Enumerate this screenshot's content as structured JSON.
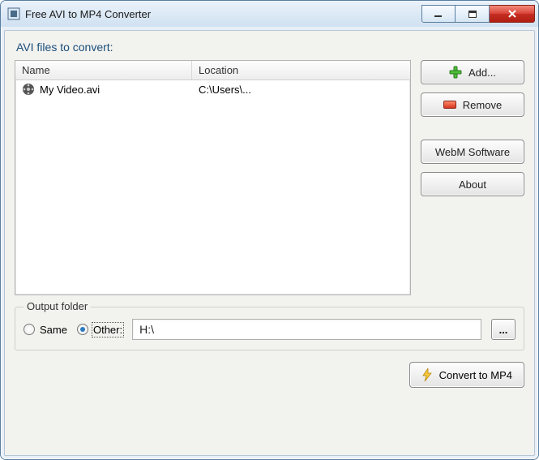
{
  "titlebar": {
    "title": "Free AVI to MP4 Converter"
  },
  "section_label": "AVI files to convert:",
  "list": {
    "headers": {
      "name": "Name",
      "location": "Location"
    },
    "rows": [
      {
        "name": "My Video.avi",
        "location": "C:\\Users\\..."
      }
    ]
  },
  "buttons": {
    "add": "Add...",
    "remove": "Remove",
    "webm": "WebM Software",
    "about": "About",
    "browse": "...",
    "convert": "Convert to MP4"
  },
  "output": {
    "legend": "Output folder",
    "same_label": "Same",
    "other_label": "Other:",
    "path": "H:\\"
  }
}
